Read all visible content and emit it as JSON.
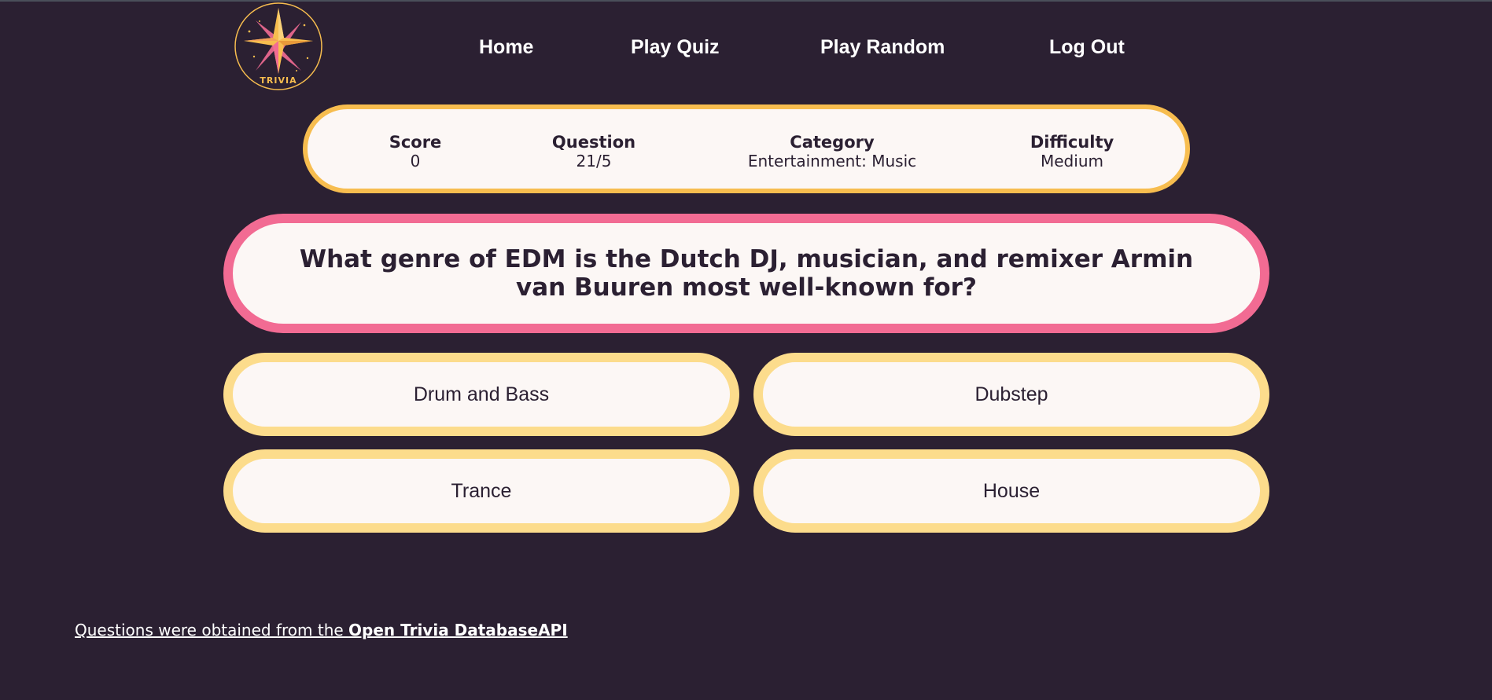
{
  "logo": {
    "text": "TRIVIA",
    "icon": "compass-star-icon",
    "colors": {
      "primary": "#f7bd4f",
      "secondary": "#f26b93"
    }
  },
  "nav": {
    "items": [
      {
        "label": "Home"
      },
      {
        "label": "Play Quiz"
      },
      {
        "label": "Play Random"
      },
      {
        "label": "Log Out"
      }
    ]
  },
  "stats": {
    "score": {
      "label": "Score",
      "value": "0"
    },
    "question": {
      "label": "Question",
      "value": "21/5"
    },
    "category": {
      "label": "Category",
      "value": "Entertainment: Music"
    },
    "difficulty": {
      "label": "Difficulty",
      "value": "Medium"
    }
  },
  "question": {
    "text": "What genre of EDM is the Dutch DJ, musician, and remixer Armin van Buuren most well-known for?"
  },
  "answers": [
    {
      "label": "Drum and Bass"
    },
    {
      "label": "Dubstep"
    },
    {
      "label": "Trance"
    },
    {
      "label": "House"
    }
  ],
  "footer": {
    "text": "Questions were obtained from the ",
    "link": "Open Trivia DatabaseAPI"
  },
  "colors": {
    "background": "#2b2032",
    "card": "#fcf7f5",
    "stats_border": "#f7bd4f",
    "question_border": "#f26b93",
    "answer_border": "#fcdc8c"
  }
}
